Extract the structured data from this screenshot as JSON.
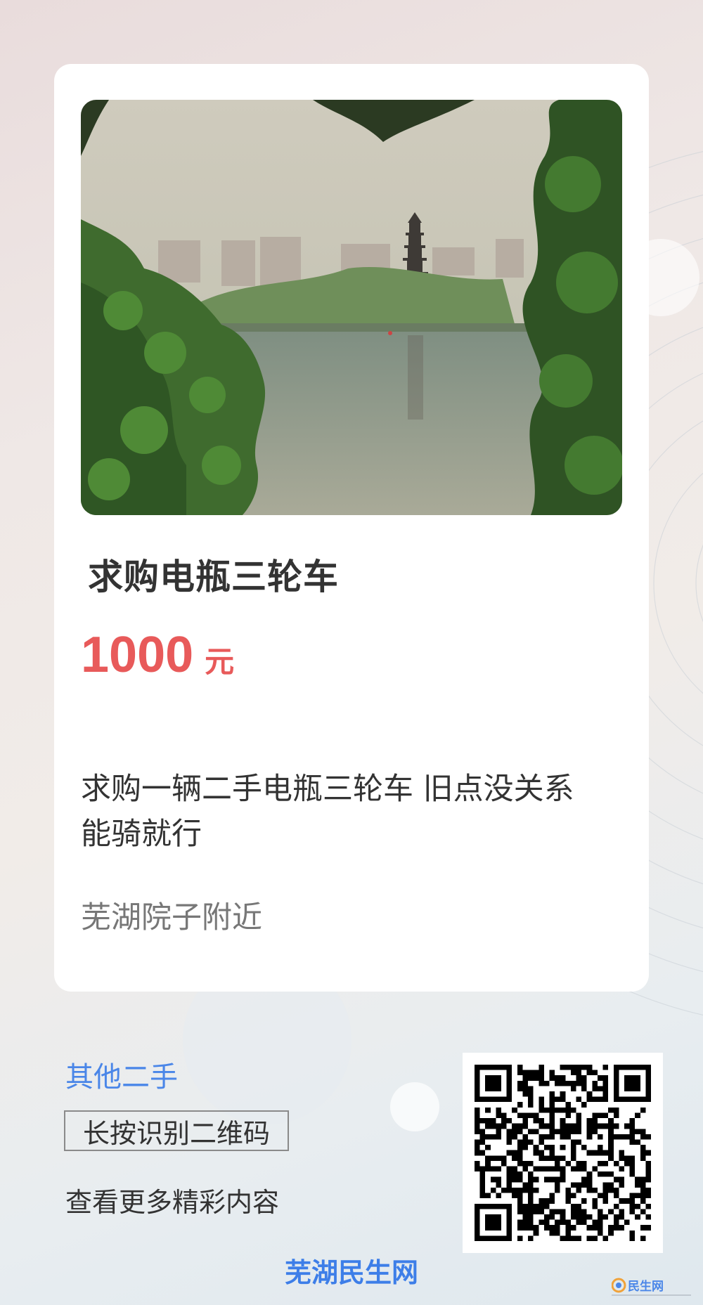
{
  "post": {
    "title": "求购电瓶三轮车",
    "price": "1000",
    "price_unit": "元",
    "description": "求购一辆二手电瓶三轮车  旧点没关系  能骑就行",
    "location": "芜湖院子附近"
  },
  "footer": {
    "category_link": "其他二手",
    "scan_hint": "长按识别二维码",
    "more_text": "查看更多精彩内容",
    "brand": "芜湖民生网"
  },
  "watermark": {
    "logo_text": "民生网"
  },
  "colors": {
    "price": "#e85a5a",
    "link": "#4a86e8",
    "brand": "#3d7ee8"
  },
  "icons": {
    "qr": "qr-code",
    "watermark": "minsheng-logo"
  }
}
